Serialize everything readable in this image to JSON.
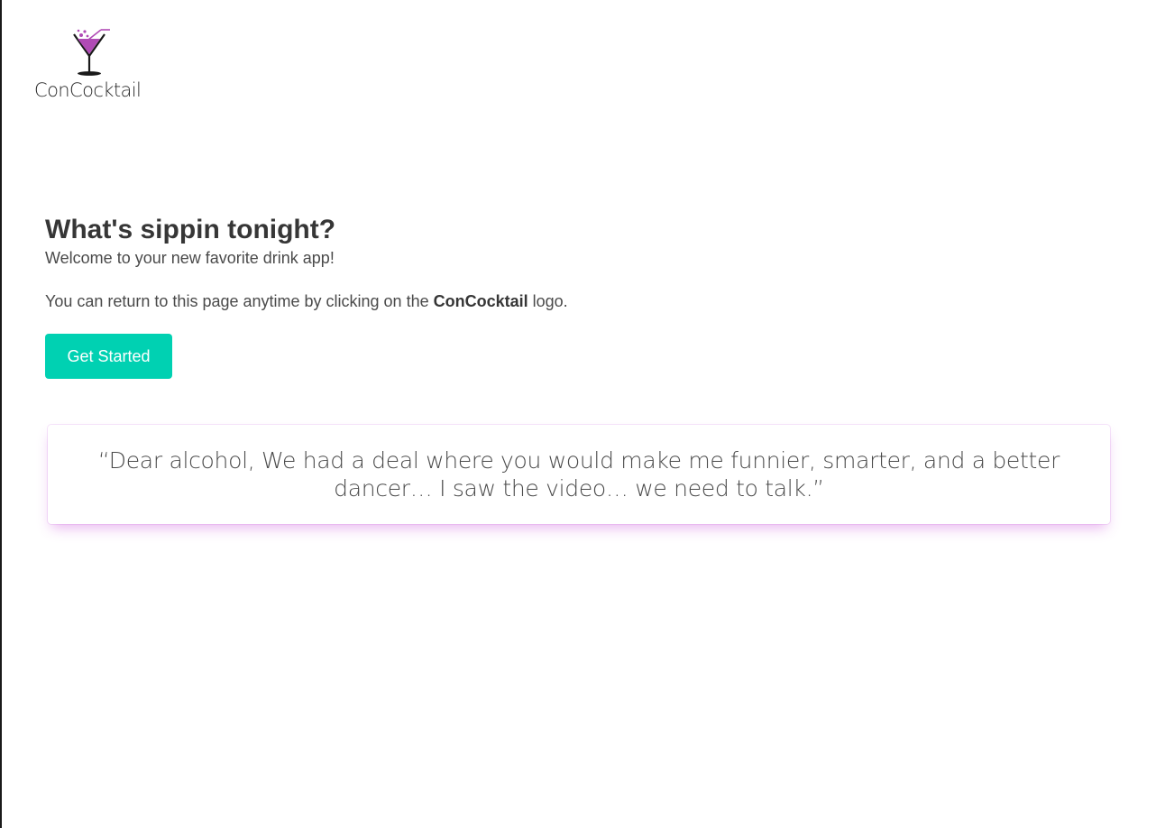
{
  "brand": {
    "name": "ConCocktail",
    "logo_icon": "martini-glass-icon",
    "logo_accent_color": "#b04bb5",
    "logo_glass_color": "#1a1a1a"
  },
  "hero": {
    "title": "What's sippin tonight?",
    "subtitle": "Welcome to your new favorite drink app!",
    "note_prefix": "You can return to this page anytime by clicking on the",
    "note_brand": "ConCocktail",
    "note_suffix": "logo.",
    "cta_label": "Get Started",
    "cta_color": "#00d1b2"
  },
  "quote": {
    "text": "“Dear alcohol, We had a deal where you would make me funnier, smarter, and a better dancer… I saw the video… we need to talk.”",
    "shadow_color": "#cd5adc"
  }
}
